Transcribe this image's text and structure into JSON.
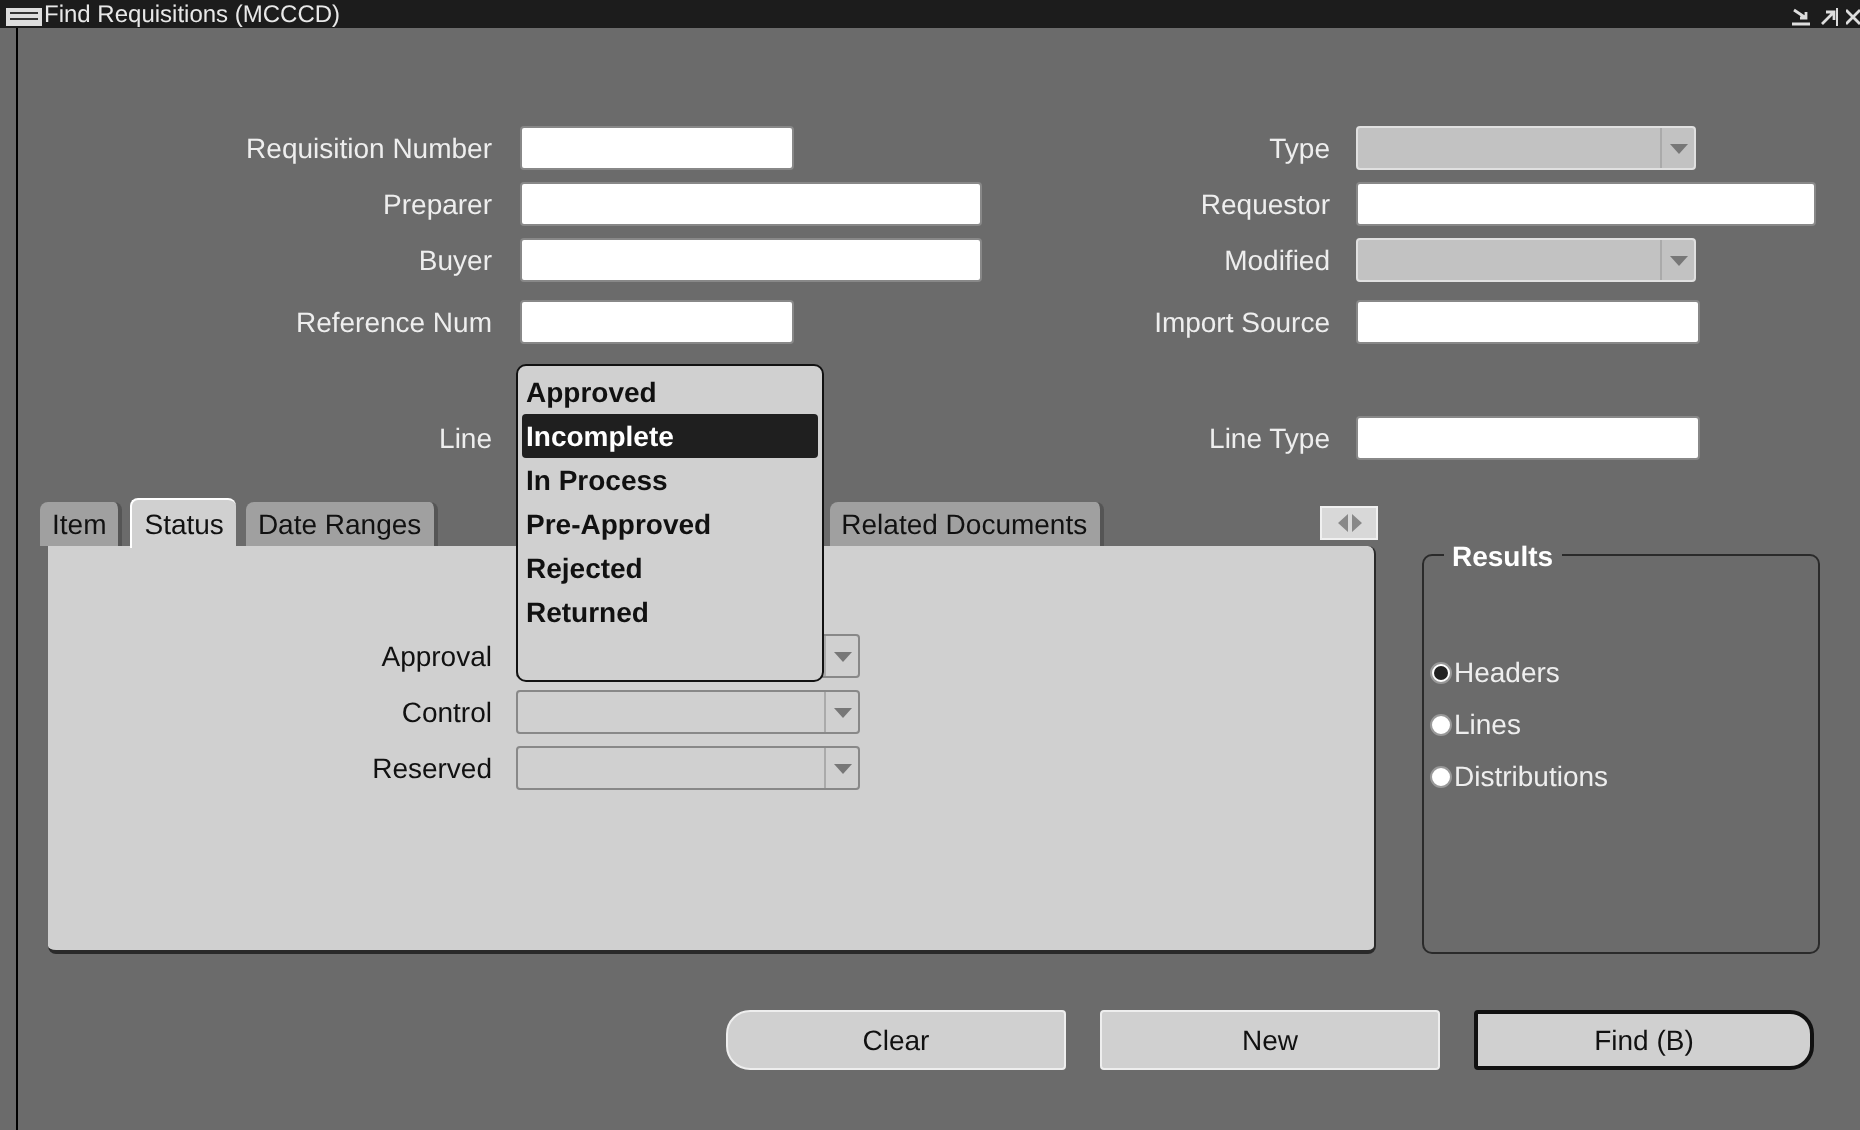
{
  "window": {
    "title": "Find Requisitions (MCCCD)"
  },
  "left_fields": [
    {
      "label": "Requisition Number",
      "kind": "text"
    },
    {
      "label": "Preparer",
      "kind": "text"
    },
    {
      "label": "Buyer",
      "kind": "text"
    },
    {
      "label": "Reference Num",
      "kind": "text"
    },
    {
      "label": "Line",
      "kind": "covered"
    }
  ],
  "right_fields": [
    {
      "label": "Type",
      "kind": "dropdown"
    },
    {
      "label": "Requestor",
      "kind": "text"
    },
    {
      "label": "Modified",
      "kind": "dropdown"
    },
    {
      "label": "Import Source",
      "kind": "text"
    },
    {
      "label": "Line Type",
      "kind": "text"
    }
  ],
  "popup": {
    "options": [
      {
        "label": "Approved",
        "selected": false
      },
      {
        "label": "Incomplete",
        "selected": true
      },
      {
        "label": "In Process",
        "selected": false
      },
      {
        "label": "Pre-Approved",
        "selected": false
      },
      {
        "label": "Rejected",
        "selected": false
      },
      {
        "label": "Returned",
        "selected": false
      }
    ]
  },
  "tabs": [
    {
      "label": "Item",
      "selected": false
    },
    {
      "label": "Status",
      "selected": true
    },
    {
      "label": "Date Ranges",
      "selected": false
    },
    {
      "label": "Related Documents",
      "selected": false
    }
  ],
  "status_fields": [
    {
      "label": "Approval"
    },
    {
      "label": "Control"
    },
    {
      "label": "Reserved"
    }
  ],
  "results": {
    "title": "Results",
    "options": [
      {
        "label": "Headers",
        "selected": true
      },
      {
        "label": "Lines",
        "selected": false
      },
      {
        "label": "Distributions",
        "selected": false
      }
    ]
  },
  "buttons": [
    {
      "label": "Clear",
      "kind": "left"
    },
    {
      "label": "New",
      "kind": "normal"
    },
    {
      "label": "Find (B)",
      "kind": "default"
    }
  ]
}
